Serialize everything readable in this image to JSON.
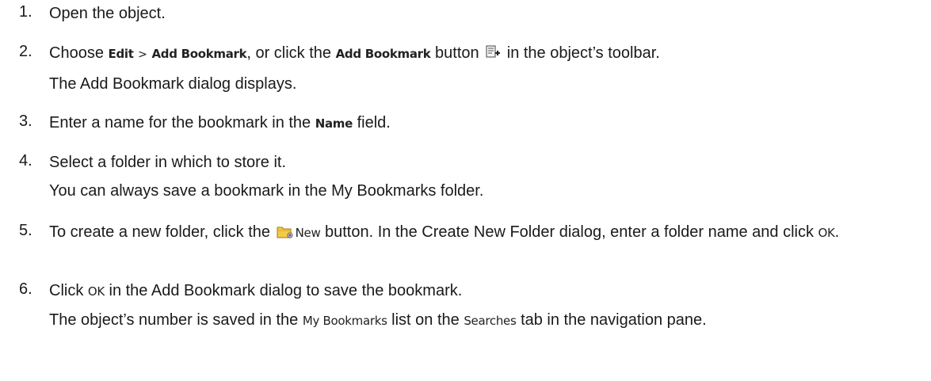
{
  "steps": [
    {
      "number": "1.",
      "text": "Open the object."
    },
    {
      "number": "2.",
      "t1": "Choose ",
      "menu_edit": "Edit",
      "sep": ">",
      "menu_add_bookmark": "Add Bookmark",
      "t2": ", or click the ",
      "button_add_bookmark": "Add Bookmark",
      "t3": " button",
      "t4": " in the object’s toolbar.",
      "icon": "add-bookmark-icon",
      "result": "The Add Bookmark dialog displays."
    },
    {
      "number": "3.",
      "t1": "Enter a name for the bookmark in the ",
      "field_name": "Name",
      "t2": " field."
    },
    {
      "number": "4.",
      "text": "Select a folder in which to store it.",
      "note": "You can always save a bookmark in the My Bookmarks folder."
    },
    {
      "number": "5.",
      "t1": "To create a new folder, click the ",
      "icon": "new-folder-icon",
      "button_new": "New",
      "t2": " button. In the Create New Folder dialog, enter a folder name and click ",
      "button_ok": "OK",
      "t3": "."
    },
    {
      "number": "6.",
      "t1": "Click ",
      "button_ok": "OK",
      "t2": " in the Add Bookmark dialog to save the bookmark.",
      "r1": "The object’s number is saved in the ",
      "list_my_bookmarks": "My Bookmarks",
      "r2": " list on the ",
      "tab_searches": "Searches",
      "r3": " tab in the navigation pane."
    }
  ]
}
